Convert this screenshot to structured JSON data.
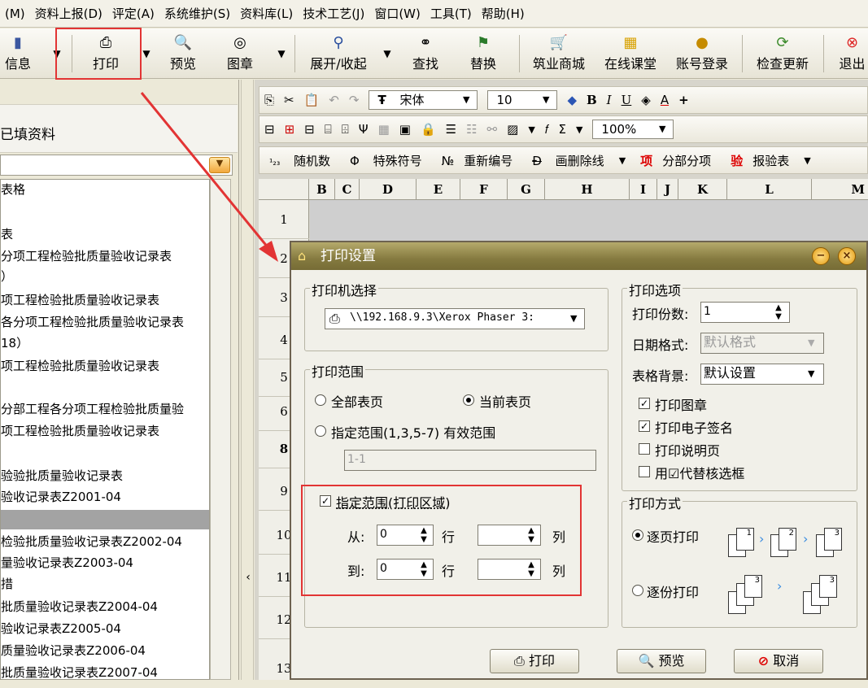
{
  "menu": [
    "(M)",
    "资料上报(D)",
    "评定(A)",
    "系统维护(S)",
    "资料库(L)",
    "技术工艺(J)",
    "窗口(W)",
    "工具(T)",
    "帮助(H)"
  ],
  "toolbar": {
    "info": "信息",
    "print": "打印",
    "preview": "预览",
    "stamp": "图章",
    "expand": "展开/收起",
    "find": "查找",
    "replace": "替换",
    "mall": "筑业商城",
    "course": "在线课堂",
    "login": "账号登录",
    "update": "检查更新",
    "exit": "退出"
  },
  "left_panel": {
    "header": "已填资料",
    "tree_root": "表格",
    "items": [
      "表",
      "分项工程检验批质量验收记录表",
      "）",
      "项工程检验批质量验收记录表",
      "各分项工程检验批质量验收记录表",
      "18）",
      "项工程检验批质量验收记录表",
      "",
      "分部工程各分项工程检验批质量验",
      "项工程检验批质量验收记录表",
      "",
      "验验批质量验收记录表",
      "验收记录表Z2001-04",
      "",
      "检验批质量验收记录表Z2002-04",
      "量验收记录表Z2003-04",
      "措",
      "批质量验收记录表Z2004-04",
      "验收记录表Z2005-04",
      "质量验收记录表Z2006-04",
      "批质量验收记录表Z2007-04"
    ]
  },
  "format_bar": {
    "font": "宋体",
    "size": "10",
    "zoom": "100%",
    "random": "随机数",
    "special": "特殊符号",
    "renumber": "重新编号",
    "strike": "画删除线",
    "subitem": "分部分项",
    "report": "报验表"
  },
  "columns": [
    "B",
    "C",
    "D",
    "E",
    "F",
    "G",
    "H",
    "I",
    "J",
    "K",
    "L",
    "M"
  ],
  "rows": [
    "1",
    "2",
    "3",
    "4",
    "5",
    "6",
    "8",
    "9",
    "10",
    "11",
    "12",
    "13"
  ],
  "dialog": {
    "title": "打印设置",
    "printer_group": "打印机选择",
    "printer": "\\\\192.168.9.3\\Xerox Phaser 3:",
    "range_group": "打印范围",
    "all_pages": "全部表页",
    "current_page": "当前表页",
    "specify_range": "指定范围(1,3,5-7) 有效范围",
    "range_value": "1-1",
    "area_check": "指定范围(打印区域)",
    "from": "从:",
    "to": "到:",
    "row": "行",
    "col": "列",
    "from_row": "0",
    "to_row": "0",
    "options_group": "打印选项",
    "copies_label": "打印份数:",
    "copies": "1",
    "date_label": "日期格式:",
    "date_value": "默认格式",
    "bg_label": "表格背景:",
    "bg_value": "默认设置",
    "opt_stamp": "打印图章",
    "opt_esign": "打印电子签名",
    "opt_note": "打印说明页",
    "opt_check": "用☑代替核选框",
    "mode_group": "打印方式",
    "mode_page": "逐页打印",
    "mode_copy": "逐份打印",
    "btn_print": "打印",
    "btn_preview": "预览",
    "btn_cancel": "取消"
  },
  "colors": {
    "highlight": "#e23434",
    "title_bar": "#857a40",
    "selected_row": "#a3a3a3"
  }
}
